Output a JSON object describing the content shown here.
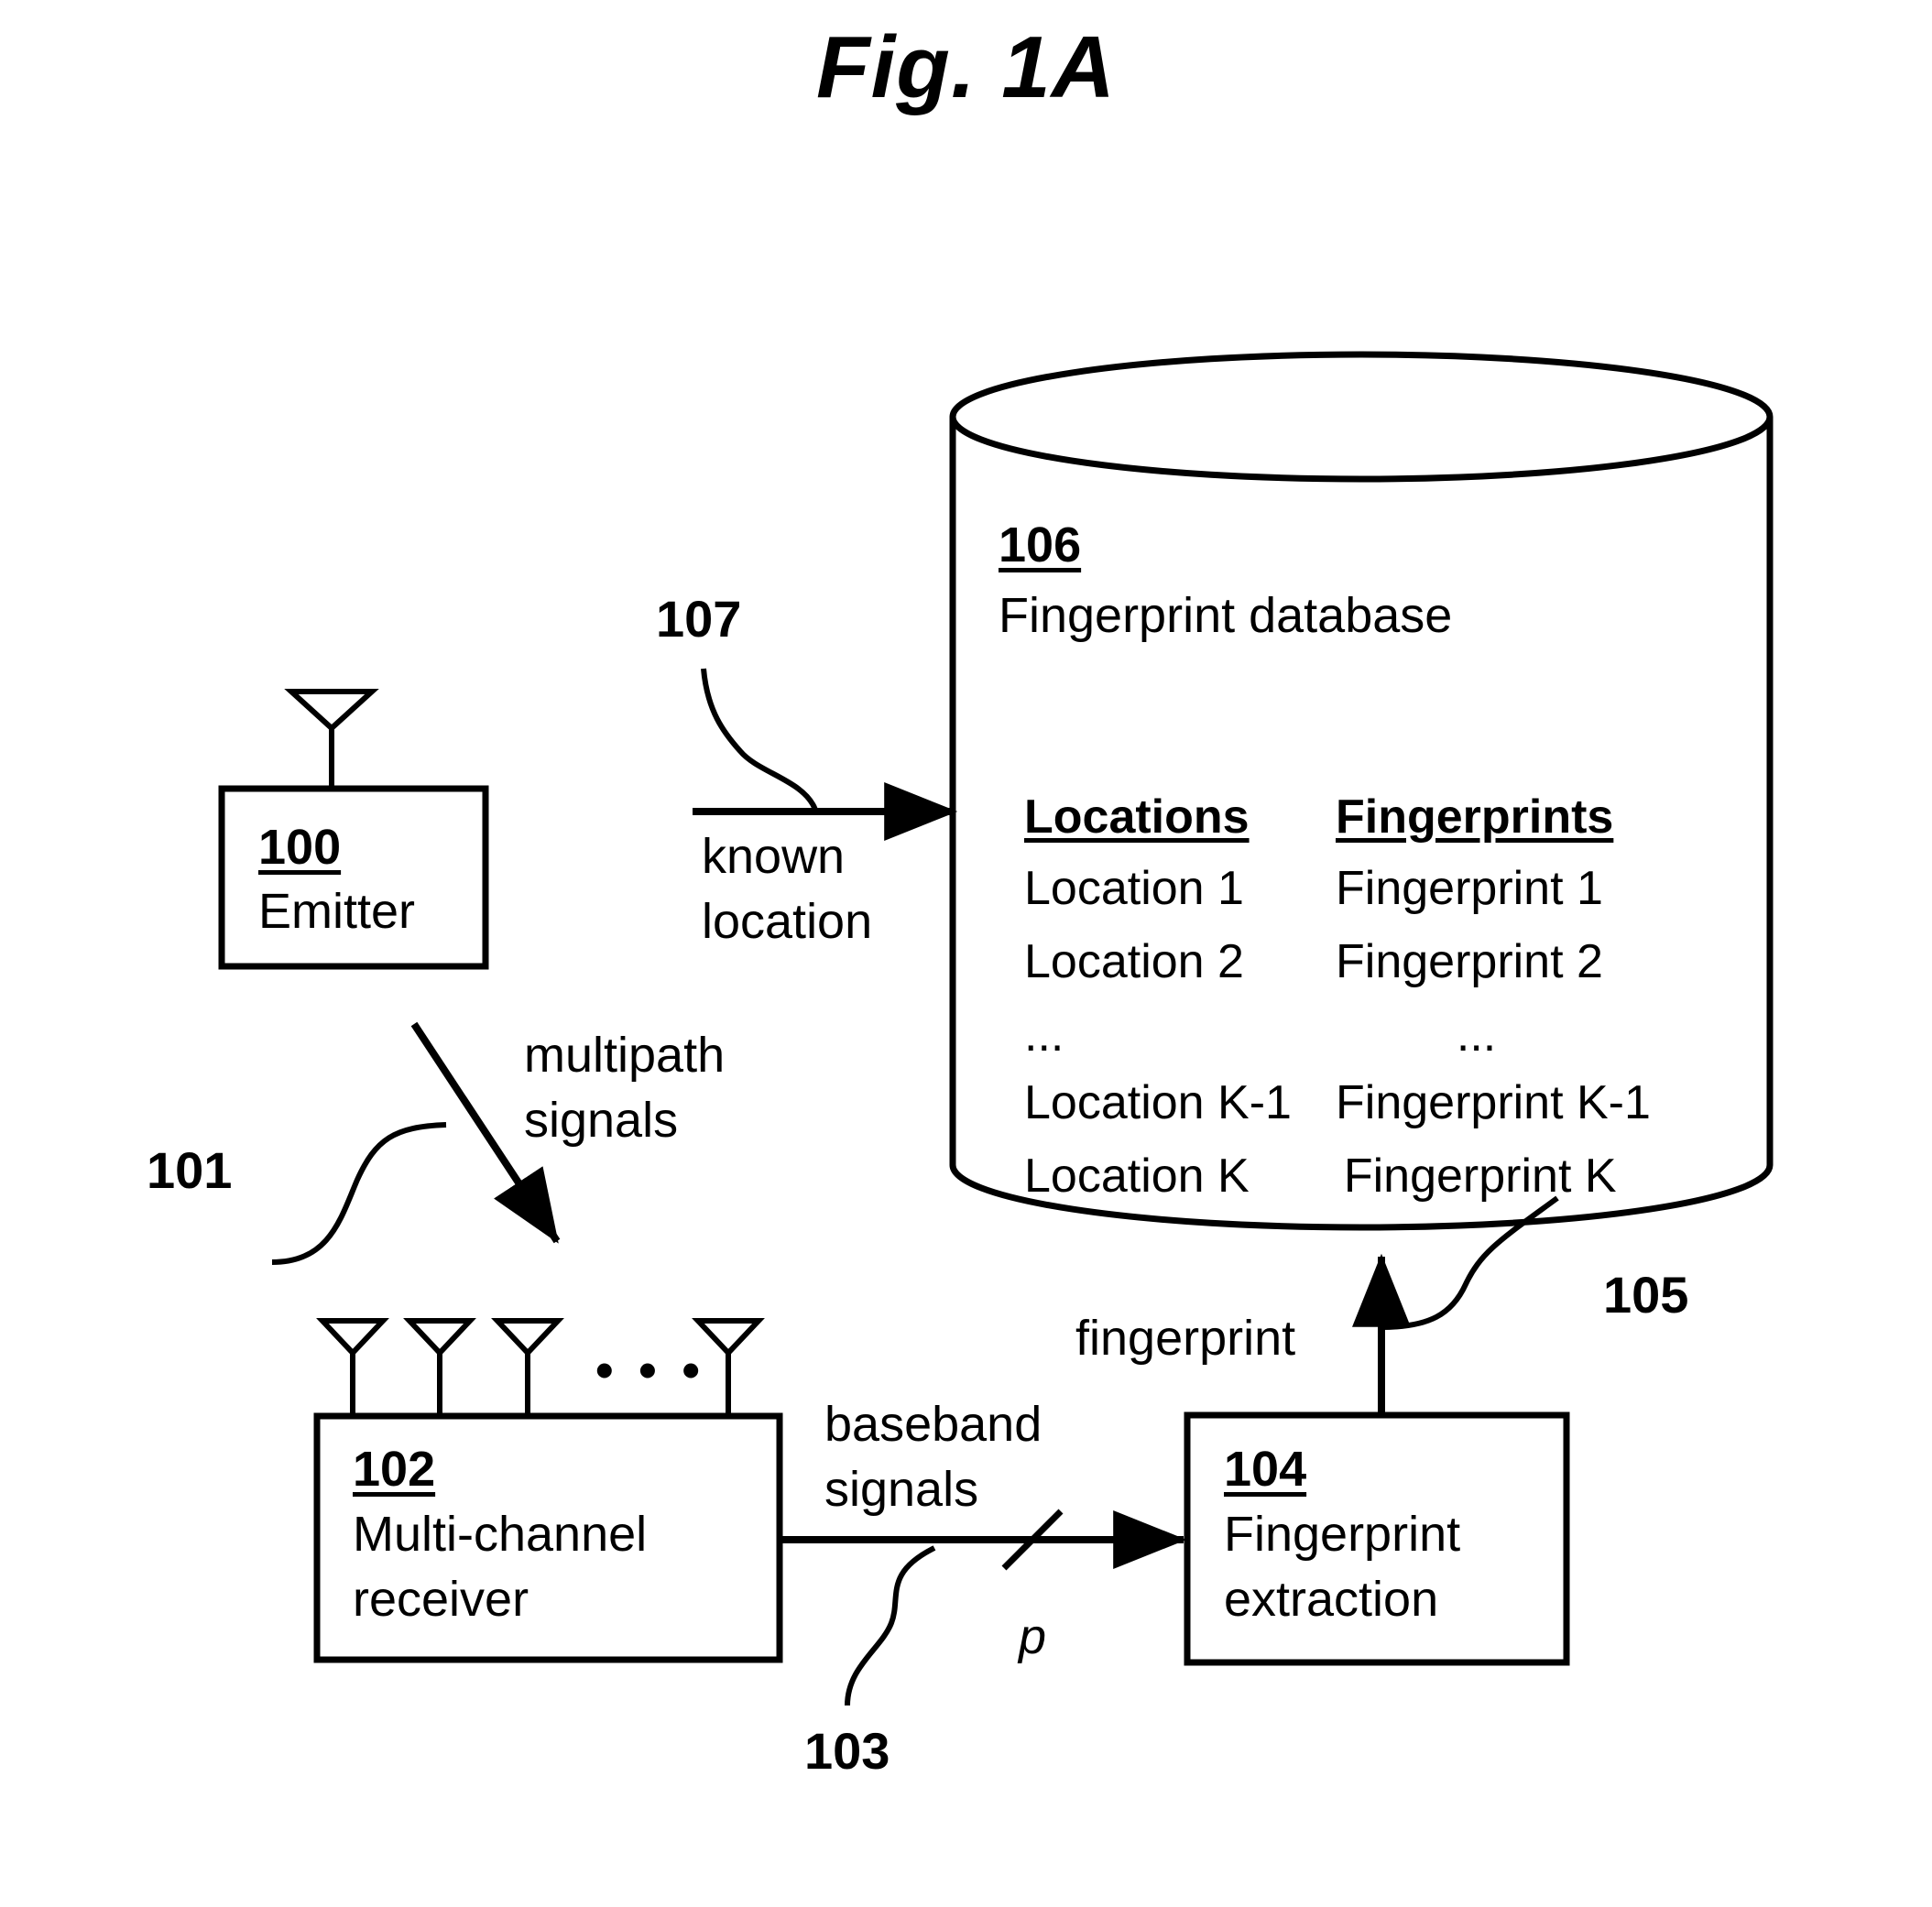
{
  "figure": {
    "title": "Fig. 1A"
  },
  "emitter": {
    "ref": "100",
    "label": "Emitter",
    "antenna_icon": "antenna-icon"
  },
  "multipath": {
    "callout": "101",
    "line1": "multipath",
    "line2": "signals"
  },
  "receiver": {
    "ref": "102",
    "label_line1": "Multi-channel",
    "label_line2": "receiver",
    "antenna_ellipsis": "• • •"
  },
  "baseband": {
    "callout": "103",
    "line1": "baseband",
    "line2": "signals",
    "bus_width": "p"
  },
  "extraction": {
    "ref": "104",
    "label_line1": "Fingerprint",
    "label_line2": "extraction"
  },
  "fingerprint_link": {
    "callout": "105",
    "label": "fingerprint"
  },
  "database": {
    "ref": "106",
    "title": "Fingerprint database",
    "table": {
      "headers": [
        "Locations",
        "Fingerprints"
      ],
      "rows": [
        [
          "Location 1",
          "Fingerprint 1"
        ],
        [
          "Location 2",
          "Fingerprint 2"
        ],
        [
          "...",
          "..."
        ],
        [
          "Location K-1",
          "Fingerprint K-1"
        ],
        [
          "Location K",
          "Fingerprint K"
        ]
      ]
    }
  },
  "known_location": {
    "callout": "107",
    "line1": "known",
    "line2": "location"
  },
  "colors": {
    "ink": "#000000",
    "paper": "#ffffff"
  }
}
